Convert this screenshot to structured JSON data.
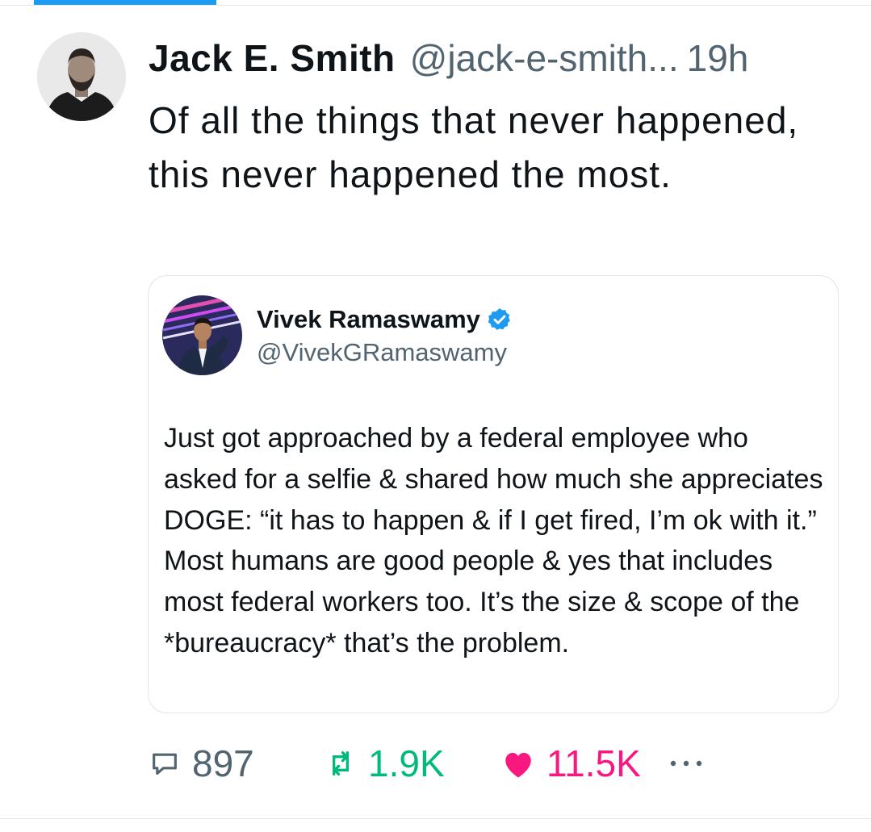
{
  "tweet": {
    "author": {
      "display_name": "Jack E. Smith",
      "handle": "@jack-e-smith...",
      "time": "19h"
    },
    "text": "Of all the things that never happened, this never happened the most."
  },
  "quoted_tweet": {
    "author": {
      "display_name": "Vivek Ramaswamy",
      "handle": "@VivekGRamaswamy",
      "verified": true
    },
    "text": "Just got approached by a federal employee who asked for a selfie & shared how much she appreciates DOGE: “it has to happen & if I get fired, I’m ok with it.” Most humans are good people & yes that includes most federal workers too. It’s the size & scope of the *bureaucracy* that’s the problem."
  },
  "actions": {
    "reply": {
      "icon": "reply-icon",
      "count": "897"
    },
    "retweet": {
      "icon": "retweet-icon",
      "count": "1.9K"
    },
    "like": {
      "icon": "heart-icon",
      "count": "11.5K"
    },
    "more": {
      "icon": "more-icon"
    }
  },
  "colors": {
    "accent": "#1d9bf0",
    "text": "#0f1419",
    "secondary": "#536471",
    "retweet": "#00ba7c",
    "like": "#f91880"
  }
}
